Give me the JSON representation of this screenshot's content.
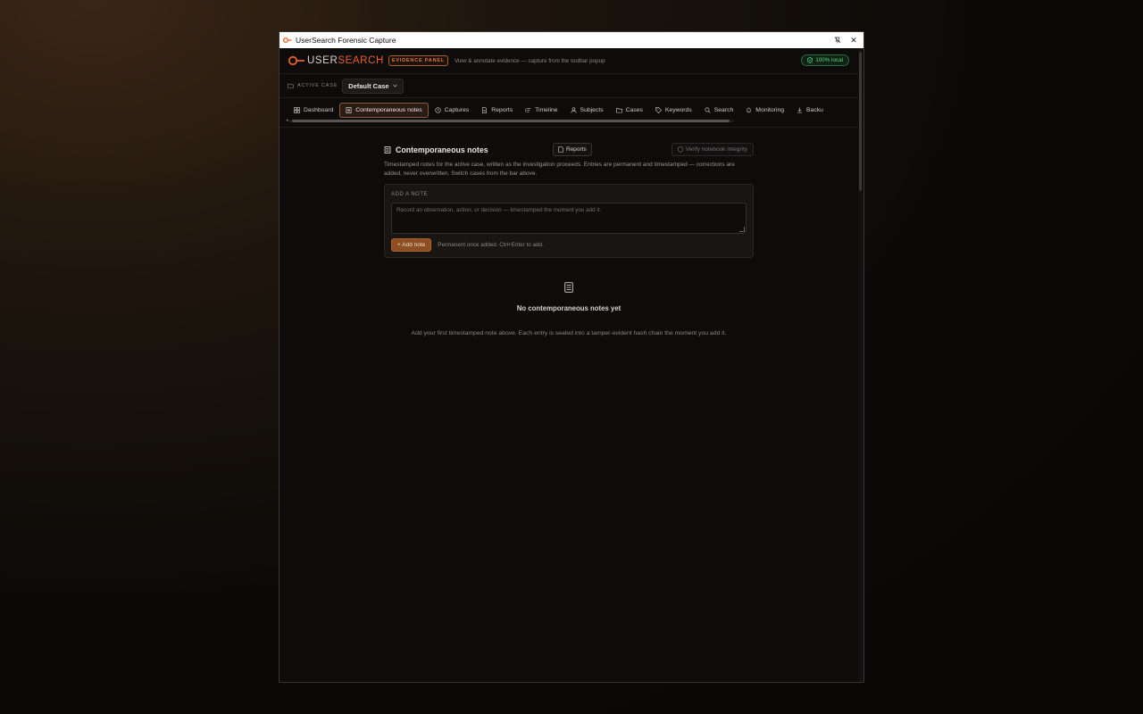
{
  "window": {
    "title": "UserSearch Forensic Capture",
    "pin_glyph": "⌖",
    "close_glyph": "✕"
  },
  "header": {
    "logo_user": "USER",
    "logo_search": "SEARCH",
    "badge": "EVIDENCE PANEL",
    "tagline": "View & annotate evidence — capture from the toolbar popup",
    "local_status": "100% local"
  },
  "casebar": {
    "label": "ACTIVE CASE",
    "selected_case": "Default Case"
  },
  "tabs": [
    {
      "label": "Dashboard",
      "icon": "grid-icon"
    },
    {
      "label": "Contemporaneous notes",
      "icon": "document-icon",
      "active": true
    },
    {
      "label": "Captures",
      "icon": "history-icon"
    },
    {
      "label": "Reports",
      "icon": "report-icon"
    },
    {
      "label": "Timeline",
      "icon": "list-icon"
    },
    {
      "label": "Subjects",
      "icon": "user-icon"
    },
    {
      "label": "Cases",
      "icon": "folder-icon"
    },
    {
      "label": "Keywords",
      "icon": "tag-icon"
    },
    {
      "label": "Search",
      "icon": "search-icon"
    },
    {
      "label": "Monitoring",
      "icon": "bell-icon"
    },
    {
      "label": "Backu",
      "icon": "download-icon"
    }
  ],
  "notes": {
    "title": "Contemporaneous notes",
    "reports_button": "Reports",
    "verify_button": "Verify notebook integrity",
    "description": "Timestamped notes for the active case, written as the investigation proceeds. Entries are permanent and timestamped — corrections are added, never overwritten. Switch cases from the bar above.",
    "add_card": {
      "label": "ADD A NOTE",
      "placeholder": "Record an observation, action, or decision — timestamped the moment you add it.",
      "add_button": "+ Add note",
      "hint": "Permanent once added. Ctrl+Enter to add."
    },
    "empty": {
      "title": "No contemporaneous notes yet",
      "subtitle": "Add your first timestamped note above. Each entry is sealed into a tamper-evident hash chain the moment you add it."
    }
  },
  "colors": {
    "accent": "#e8602c",
    "success": "#5bd27e",
    "background": "#0e0c0b"
  }
}
